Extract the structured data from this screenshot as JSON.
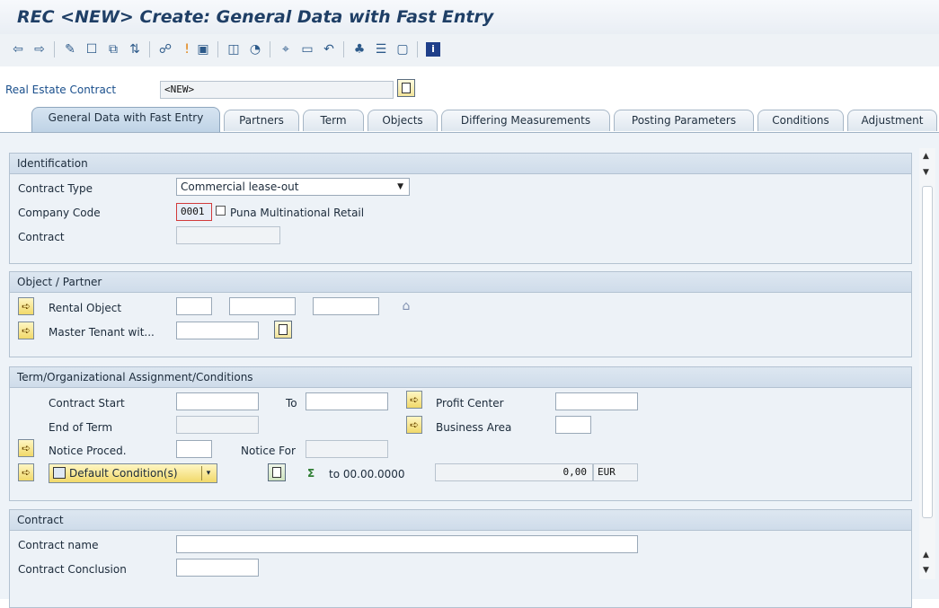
{
  "window": {
    "title": "REC <NEW> Create: General Data with Fast Entry"
  },
  "toolbar": {
    "icons": [
      "back-arrow-icon",
      "forward-arrow-icon",
      "edit-icon",
      "new-document-icon",
      "copy-icon",
      "replace-icon",
      "hierarchy-icon",
      "info-marker-icon",
      "save-variant-icon",
      "display-icon",
      "paint-icon",
      "connect-icon",
      "document-icon",
      "undo-icon",
      "org-chart-icon",
      "table-icon",
      "screen-icon",
      "info-icon"
    ]
  },
  "header": {
    "contract_label": "Real Estate Contract",
    "contract_value": "<NEW>"
  },
  "tabs": [
    "General Data with Fast Entry",
    "Partners",
    "Term",
    "Objects",
    "Differing Measurements",
    "Posting Parameters",
    "Conditions",
    "Adjustment"
  ],
  "identification": {
    "title": "Identification",
    "contract_type_label": "Contract Type",
    "contract_type_value": "Commercial lease-out",
    "company_code_label": "Company Code",
    "company_code_value": "0001",
    "company_name": "Puna Multinational Retail",
    "contract_label": "Contract"
  },
  "object_partner": {
    "title": "Object / Partner",
    "rental_object_label": "Rental Object",
    "master_tenant_label": "Master Tenant wit..."
  },
  "term": {
    "title": "Term/Organizational Assignment/Conditions",
    "contract_start_label": "Contract Start",
    "to_label": "To",
    "profit_center_label": "Profit Center",
    "end_of_term_label": "End of Term",
    "business_area_label": "Business Area",
    "notice_proced_label": "Notice Proced.",
    "notice_for_label": "Notice For",
    "default_conditions_label": "Default Condition(s)",
    "to_date_text": "to 00.00.0000",
    "amount_value": "0,00",
    "currency": "EUR"
  },
  "contract": {
    "title": "Contract",
    "contract_name_label": "Contract name",
    "contract_conclusion_label": "Contract Conclusion"
  }
}
